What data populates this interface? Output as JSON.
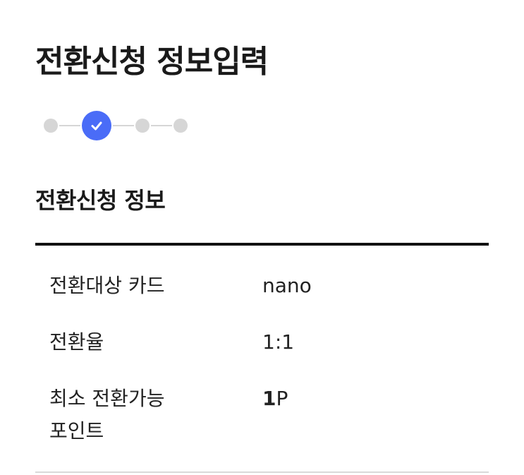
{
  "page": {
    "title": "전환신청 정보입력"
  },
  "stepper": {
    "total_steps": 4,
    "current_step": 2,
    "accent_color": "#4a6cf7",
    "inactive_color": "#d6d6d6",
    "active_icon": "check-icon"
  },
  "section": {
    "title": "전환신청 정보"
  },
  "info": {
    "target_card": {
      "label": "전환대상 카드",
      "value": "nano"
    },
    "rate": {
      "label": "전환율",
      "value": "1:1"
    },
    "min_points": {
      "label_line1": "최소 전환가능",
      "label_line2": "포인트",
      "value_number": "1",
      "value_unit": "P"
    }
  }
}
